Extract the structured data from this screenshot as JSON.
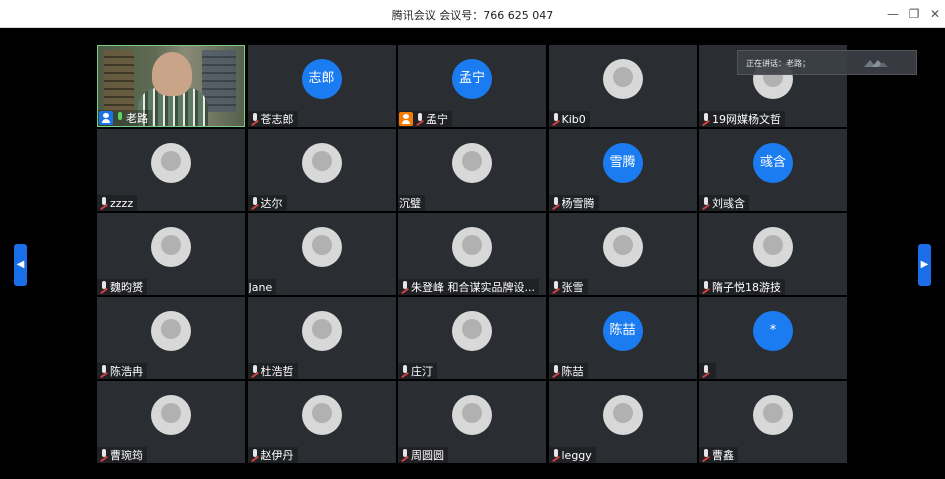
{
  "window": {
    "title": "腾讯会议 会议号：766 625 047",
    "minimize_label": "—",
    "restore_label": "❐",
    "close_label": "✕"
  },
  "speaking_indicator": {
    "text": "正在讲话：老路；"
  },
  "pager": {
    "prev_label": "◀",
    "next_label": "▶"
  },
  "colors": {
    "avatar_blue": "#1b7cf2",
    "host_blue": "#1a73e8",
    "cohost_orange": "#f57c00",
    "mic_muted_red": "#cc4444",
    "mic_on_green": "#5fd35f"
  },
  "participants": [
    {
      "name": "老路",
      "kind": "video",
      "role": "host",
      "mic": "on"
    },
    {
      "name": "苍志郎",
      "kind": "initials",
      "initials": "志郎",
      "mic": "muted"
    },
    {
      "name": "孟宁",
      "kind": "initials",
      "initials": "孟宁",
      "role": "cohost",
      "mic": "muted"
    },
    {
      "name": "Kib0",
      "kind": "image",
      "mic": "muted"
    },
    {
      "name": "19网媒杨文哲",
      "kind": "image",
      "mic": "muted"
    },
    {
      "name": "zzzz",
      "kind": "image",
      "mic": "muted"
    },
    {
      "name": "达尔",
      "kind": "image",
      "mic": "muted"
    },
    {
      "name": "沉璧",
      "kind": "image",
      "mic": "none"
    },
    {
      "name": "杨雪腾",
      "kind": "initials",
      "initials": "雪腾",
      "mic": "muted"
    },
    {
      "name": "刘彧含",
      "kind": "initials",
      "initials": "彧含",
      "mic": "muted"
    },
    {
      "name": "魏昀赟",
      "kind": "image",
      "mic": "muted"
    },
    {
      "name": "Jane",
      "kind": "image",
      "mic": "none"
    },
    {
      "name": "朱登峰 和合谋实品牌设...",
      "kind": "image",
      "mic": "muted"
    },
    {
      "name": "张雪",
      "kind": "image",
      "mic": "muted"
    },
    {
      "name": "隋子悦18游技",
      "kind": "image",
      "mic": "muted"
    },
    {
      "name": "陈浩冉",
      "kind": "image",
      "mic": "muted"
    },
    {
      "name": "杜浩哲",
      "kind": "image",
      "mic": "muted"
    },
    {
      "name": "庄汀",
      "kind": "image",
      "mic": "muted"
    },
    {
      "name": "陈喆",
      "kind": "initials",
      "initials": "陈喆",
      "mic": "muted"
    },
    {
      "name": "",
      "kind": "initials",
      "initials": "*",
      "mic": "muted"
    },
    {
      "name": "曹琬筠",
      "kind": "image",
      "mic": "muted"
    },
    {
      "name": "赵伊丹",
      "kind": "image",
      "mic": "muted"
    },
    {
      "name": "周圆圆",
      "kind": "image",
      "mic": "muted"
    },
    {
      "name": "leggy",
      "kind": "image",
      "mic": "muted"
    },
    {
      "name": "曹鑫",
      "kind": "image",
      "mic": "muted"
    }
  ]
}
